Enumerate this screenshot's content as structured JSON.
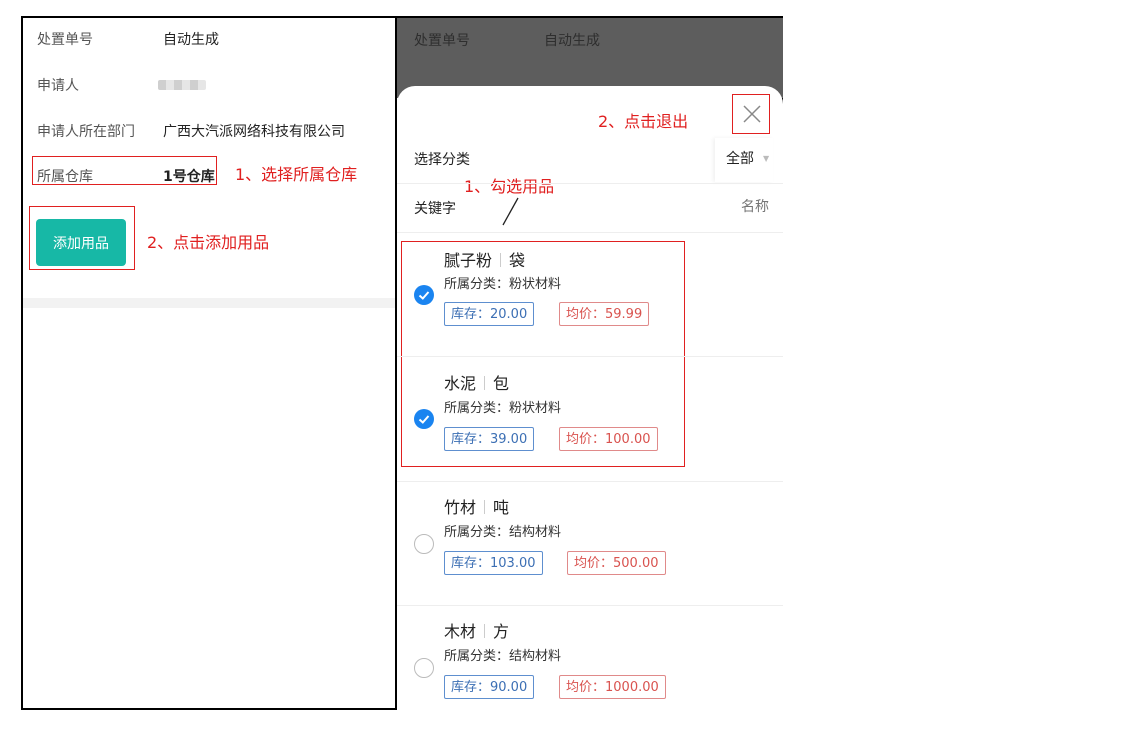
{
  "left": {
    "rows": [
      {
        "label": "处置单号",
        "value": "自动生成"
      },
      {
        "label": "申请人",
        "value": ""
      },
      {
        "label": "申请人所在部门",
        "value": "广西大汽派网络科技有限公司"
      },
      {
        "label": "所属仓库",
        "value": "1号仓库"
      }
    ],
    "add_button": "添加用品",
    "annotation_1": "1、选择所属仓库",
    "annotation_2": "2、点击添加用品"
  },
  "right": {
    "bg_row": {
      "label": "处置单号",
      "value": "自动生成"
    },
    "annotation_exit": "2、点击退出",
    "annotation_select": "1、勾选用品",
    "category_label": "选择分类",
    "category_value": "全部",
    "keyword_label": "关键字",
    "keyword_placeholder": "名称",
    "items": [
      {
        "name": "腻子粉",
        "unit": "袋",
        "category": "所属分类：粉状材料",
        "stock": "库存：20.00",
        "price": "均价：59.99",
        "checked": true
      },
      {
        "name": "水泥",
        "unit": "包",
        "category": "所属分类：粉状材料",
        "stock": "库存：39.00",
        "price": "均价：100.00",
        "checked": true
      },
      {
        "name": "竹材",
        "unit": "吨",
        "category": "所属分类：结构材料",
        "stock": "库存：103.00",
        "price": "均价：500.00",
        "checked": false
      },
      {
        "name": "木材",
        "unit": "方",
        "category": "所属分类：结构材料",
        "stock": "库存：90.00",
        "price": "均价：1000.00",
        "checked": false
      }
    ]
  },
  "colors": {
    "accent": "#17b8a6",
    "annotation": "#e02020",
    "check": "#1a84f0"
  }
}
